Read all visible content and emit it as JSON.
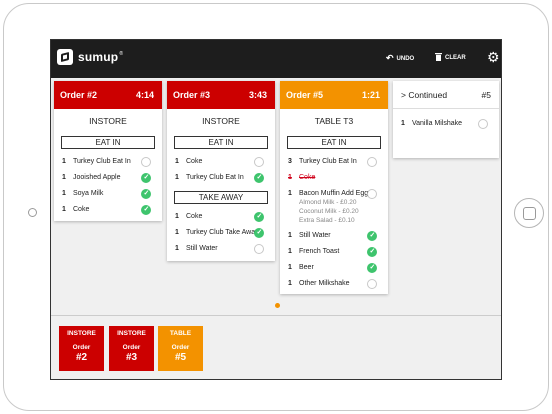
{
  "colors": {
    "red": "#cc0000",
    "orange": "#f39200",
    "check_green": "#3ec46d",
    "topbar": "#1d1d1d"
  },
  "topbar": {
    "brand": "sumup",
    "brand_sup": "®",
    "undo_label": "UNDO",
    "clear_label": "CLEAR",
    "icons": [
      "sumup-logo-icon",
      "undo-icon",
      "trash-icon",
      "gear-icon"
    ]
  },
  "orders": [
    {
      "title": "Order #2",
      "time": "4:14",
      "location": "INSTORE",
      "color": "#cc0000",
      "sections": [
        {
          "label": "EAT IN",
          "items": [
            {
              "qty": "1",
              "name": "Turkey Club Eat In",
              "done": false
            },
            {
              "qty": "1",
              "name": "Jooished Apple",
              "done": true
            },
            {
              "qty": "1",
              "name": "Soya Milk",
              "done": true
            },
            {
              "qty": "1",
              "name": "Coke",
              "done": true
            }
          ]
        }
      ]
    },
    {
      "title": "Order #3",
      "time": "3:43",
      "location": "INSTORE",
      "color": "#cc0000",
      "sections": [
        {
          "label": "EAT IN",
          "items": [
            {
              "qty": "1",
              "name": "Coke",
              "done": false
            },
            {
              "qty": "1",
              "name": "Turkey Club Eat In",
              "done": true
            }
          ]
        },
        {
          "label": "TAKE AWAY",
          "items": [
            {
              "qty": "1",
              "name": "Coke",
              "done": true
            },
            {
              "qty": "1",
              "name": "Turkey Club Take Away",
              "done": true
            },
            {
              "qty": "1",
              "name": "Still Water",
              "done": false
            }
          ]
        }
      ]
    },
    {
      "title": "Order #5",
      "time": "1:21",
      "location": "TABLE T3",
      "color": "#f39200",
      "sections": [
        {
          "label": "EAT IN",
          "items": [
            {
              "qty": "3",
              "name": "Turkey Club Eat In",
              "done": false
            },
            {
              "qty": "1",
              "name": "Coke",
              "done": false,
              "voided": true
            },
            {
              "qty": "1",
              "name": "Bacon Muffin Add Egg",
              "done": false,
              "modifiers": [
                "Almond Milk - £0.20",
                "Coconut Milk - £0.20",
                "Extra Salad - £0.10"
              ]
            },
            {
              "qty": "1",
              "name": "Still Water",
              "done": true
            },
            {
              "qty": "1",
              "name": "French Toast",
              "done": true
            },
            {
              "qty": "1",
              "name": "Beer",
              "done": true
            },
            {
              "qty": "1",
              "name": "Other Milkshake",
              "done": false
            }
          ]
        }
      ]
    }
  ],
  "continued": {
    "label": "> Continued",
    "order": "#5",
    "items": [
      {
        "qty": "1",
        "name": "Vanilla Milshake",
        "done": false
      }
    ]
  },
  "tiles": [
    {
      "type": "INSTORE",
      "label": "Order",
      "number": "#2",
      "color": "#cc0000"
    },
    {
      "type": "INSTORE",
      "label": "Order",
      "number": "#3",
      "color": "#cc0000"
    },
    {
      "type": "TABLE",
      "label": "Order",
      "number": "#5",
      "color": "#f39200"
    }
  ]
}
